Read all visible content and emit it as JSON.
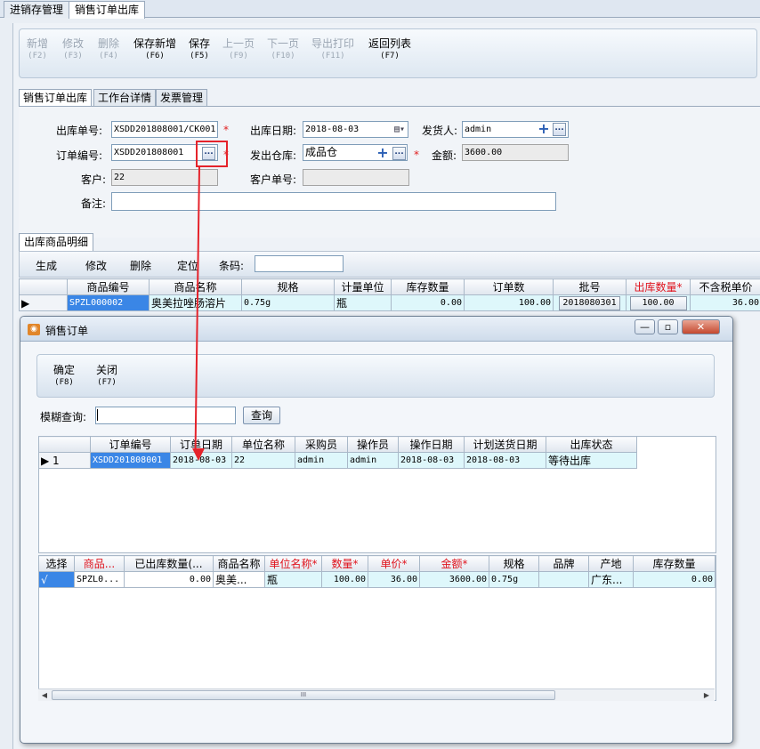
{
  "app_tabs": [
    "进销存管理",
    "销售订单出库"
  ],
  "toolbar": [
    {
      "label": "新增",
      "key": "(F2)",
      "enabled": false
    },
    {
      "label": "修改",
      "key": "(F3)",
      "enabled": false
    },
    {
      "label": "删除",
      "key": "(F4)",
      "enabled": false
    },
    {
      "label": "保存新增",
      "key": "(F6)",
      "enabled": true
    },
    {
      "label": "保存",
      "key": "(F5)",
      "enabled": true
    },
    {
      "label": "上一页",
      "key": "(F9)",
      "enabled": false
    },
    {
      "label": "下一页",
      "key": "(F10)",
      "enabled": false
    },
    {
      "label": "导出打印",
      "key": "(F11)",
      "enabled": false
    },
    {
      "label": "返回列表",
      "key": "(F7)",
      "enabled": true
    }
  ],
  "subtabs": [
    "销售订单出库",
    "工作台详情",
    "发票管理"
  ],
  "form": {
    "out_no_label": "出库单号:",
    "out_no": "XSDD201808001/CK001",
    "out_date_label": "出库日期:",
    "out_date": "2018-08-03",
    "shipper_label": "发货人:",
    "shipper": "admin",
    "order_no_label": "订单编号:",
    "order_no": "XSDD201808001",
    "warehouse_label": "发出仓库:",
    "warehouse": "成品仓",
    "amount_label": "金额:",
    "amount": "3600.00",
    "customer_label": "客户:",
    "customer": "22",
    "customer_no_label": "客户单号:",
    "customer_no": "",
    "remark_label": "备注:",
    "remark": "",
    "required_mark": "*",
    "browse_label": "...",
    "plus_label": "+"
  },
  "detail": {
    "tab": "出库商品明细",
    "buttons": [
      "生成",
      "修改",
      "删除",
      "定位"
    ],
    "barcode_label": "条码:",
    "columns": [
      "商品编号",
      "商品名称",
      "规格",
      "计量单位",
      "库存数量",
      "订单数",
      "批号",
      "出库数量*",
      "不含税单价"
    ],
    "row": {
      "code": "SPZL000002",
      "name": "奥美拉唑肠溶片",
      "spec": "0.75g",
      "unit": "瓶",
      "stock": "0.00",
      "order_qty": "100.00",
      "batch": "2018080301",
      "out_qty": "100.00",
      "price": "36.00"
    }
  },
  "dialog": {
    "title": "销售订单",
    "buttons": [
      {
        "label": "确定",
        "key": "(F8)"
      },
      {
        "label": "关闭",
        "key": "(F7)"
      }
    ],
    "search_label": "模糊查询:",
    "search_value": "",
    "query_button": "查询",
    "win_minimize": "—",
    "win_restore": "▫",
    "win_close": "✕",
    "order_columns": [
      "订单编号",
      "订单日期",
      "单位名称",
      "采购员",
      "操作员",
      "操作日期",
      "计划送货日期",
      "出库状态"
    ],
    "order_row": {
      "index": "1",
      "order_no": "XSDD201808001",
      "order_date": "2018-08-03",
      "unit": "22",
      "buyer": "admin",
      "operator": "admin",
      "op_date": "2018-08-03",
      "plan_date": "2018-08-03",
      "status": "等待出库"
    },
    "item_columns": [
      "选择",
      "商品...",
      "已出库数量(...",
      "商品名称",
      "单位名称*",
      "数量*",
      "单价*",
      "金额*",
      "规格",
      "品牌",
      "产地",
      "库存数量"
    ],
    "item_row": {
      "check": "√",
      "code": "SPZL0...",
      "out_qty": "0.00",
      "name": "奥美...",
      "unit": "瓶",
      "qty": "100.00",
      "price": "36.00",
      "amount": "3600.00",
      "spec": "0.75g",
      "brand": "",
      "origin": "广东...",
      "stock": "0.00"
    },
    "scroll_thumb": "III"
  },
  "colors": {
    "accent": "#3a86e6",
    "required": "#e0141e",
    "annotation": "#e5232b"
  }
}
